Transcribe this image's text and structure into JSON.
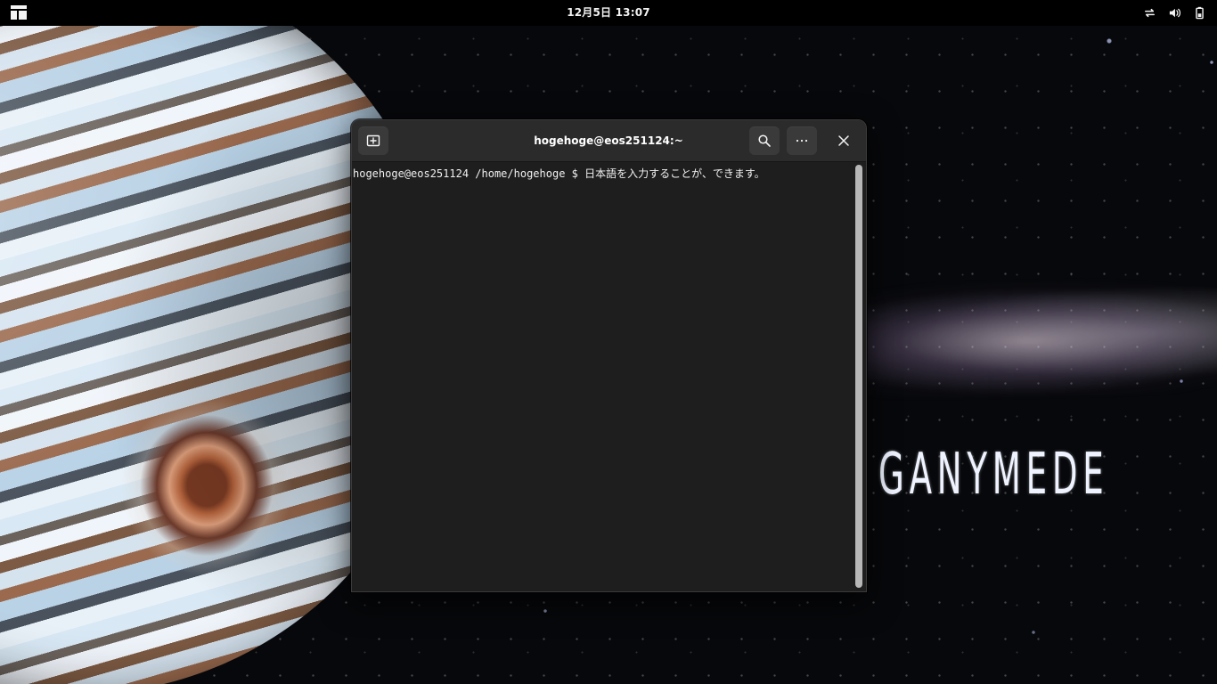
{
  "desktop": {
    "wallpaper_text": "GANYMEDE"
  },
  "top_bar": {
    "clock": "12月5日 13:07",
    "icons": {
      "activities": "activities-grid-icon",
      "network": "network-icon",
      "volume": "volume-icon",
      "battery": "battery-icon"
    }
  },
  "terminal": {
    "title": "hogehoge@eos251124:~",
    "line": "hogehoge@eos251124 /home/hogehoge $ 日本語を入力することが、できます。",
    "icons": {
      "new_tab": "new-tab-icon",
      "search": "search-icon",
      "menu": "ellipsis-icon",
      "close": "close-icon"
    }
  },
  "colors": {
    "top_bar": "#000000",
    "terminal_background": "#1e1e1e",
    "terminal_header": "#2b2b2b",
    "header_button": "#3a3a3a",
    "text": "#f1f1f1",
    "scrollbar": "#b7b7b7"
  }
}
